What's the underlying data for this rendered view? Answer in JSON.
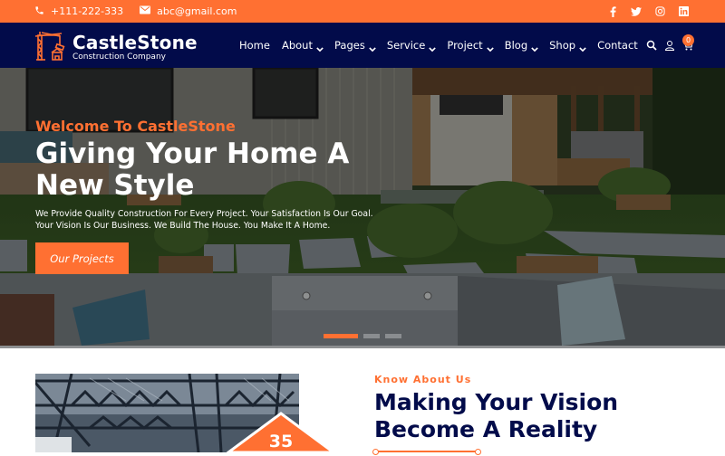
{
  "colors": {
    "accent": "#ff7032",
    "navy": "#020b4a"
  },
  "topbar": {
    "phone": "+111-222-333",
    "email": "abc@gmail.com",
    "social": [
      "facebook-icon",
      "twitter-icon",
      "instagram-icon",
      "linkedin-icon"
    ]
  },
  "navbar": {
    "brand": "CastleStone",
    "tagline": "Construction Company",
    "menu": [
      {
        "label": "Home",
        "dropdown": false
      },
      {
        "label": "About",
        "dropdown": true
      },
      {
        "label": "Pages",
        "dropdown": true
      },
      {
        "label": "Service",
        "dropdown": true
      },
      {
        "label": "Project",
        "dropdown": true
      },
      {
        "label": "Blog",
        "dropdown": true
      },
      {
        "label": "Shop",
        "dropdown": true
      },
      {
        "label": "Contact",
        "dropdown": false
      }
    ],
    "cart_count": "0"
  },
  "hero": {
    "welcome": "Welcome To CastleStone",
    "headline": "Giving Your Home A New Style",
    "subtext": "We Provide Quality Construction For Every Project. Your Satisfaction Is Our Goal. Your Vision Is Our Business. We Build The House. You Make It A Home.",
    "cta_label": "Our Projects",
    "slides": 3,
    "active_slide": 1
  },
  "about": {
    "years": "35",
    "kicker": "Know About Us",
    "title": "Making Your Vision Become A Reality"
  }
}
